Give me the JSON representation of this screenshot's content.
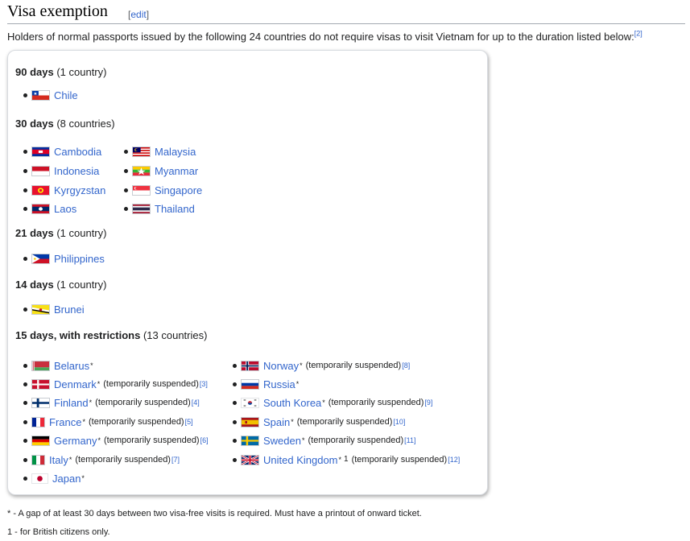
{
  "section": {
    "title": "Visa exemption",
    "edit_open": "[",
    "edit_label": "edit",
    "edit_close": "]"
  },
  "intro": {
    "text": "Holders of normal passports issued by the following 24 countries do not require visas to visit Vietnam for up to the duration listed below:",
    "ref": "[2]"
  },
  "groups": [
    {
      "label": "90 days",
      "count": "(1 country)"
    },
    {
      "label": "30 days",
      "count": "(8 countries)"
    },
    {
      "label": "21 days",
      "count": "(1 country)"
    },
    {
      "label": "14 days",
      "count": "(1 country)"
    },
    {
      "label": "15 days, with restrictions",
      "count": "(13 countries)"
    }
  ],
  "countries": {
    "chile": {
      "name": "Chile"
    },
    "cambodia": {
      "name": "Cambodia"
    },
    "indonesia": {
      "name": "Indonesia"
    },
    "kyrgyzstan": {
      "name": "Kyrgyzstan"
    },
    "laos": {
      "name": "Laos"
    },
    "malaysia": {
      "name": "Malaysia"
    },
    "myanmar": {
      "name": "Myanmar"
    },
    "singapore": {
      "name": "Singapore"
    },
    "thailand": {
      "name": "Thailand"
    },
    "philippines": {
      "name": "Philippines"
    },
    "brunei": {
      "name": "Brunei"
    },
    "belarus": {
      "name": "Belarus",
      "mark": "*"
    },
    "denmark": {
      "name": "Denmark",
      "mark": "*",
      "note": "(temporarily suspended)",
      "ref": "[3]"
    },
    "finland": {
      "name": "Finland",
      "mark": "*",
      "note": "(temporarily suspended)",
      "ref": "[4]"
    },
    "france": {
      "name": "France",
      "mark": "*",
      "note": "(temporarily suspended)",
      "ref": "[5]"
    },
    "germany": {
      "name": "Germany",
      "mark": "*",
      "note": "(temporarily suspended)",
      "ref": "[6]"
    },
    "italy": {
      "name": "Italy",
      "mark": "*",
      "note": "(temporarily suspended)",
      "ref": "[7]"
    },
    "japan": {
      "name": "Japan",
      "mark": "*"
    },
    "norway": {
      "name": "Norway",
      "mark": "*",
      "note": "(temporarily suspended)",
      "ref": "[8]"
    },
    "russia": {
      "name": "Russia",
      "mark": "*"
    },
    "southkorea": {
      "name": "South Korea",
      "mark": "*",
      "note": "(temporarily suspended)",
      "ref": "[9]"
    },
    "spain": {
      "name": "Spain",
      "mark": "*",
      "note": "(temporarily suspended)",
      "ref": "[10]"
    },
    "sweden": {
      "name": "Sweden",
      "mark": "*",
      "note": "(temporarily suspended)",
      "ref": "[11]"
    },
    "uk": {
      "name": "United Kingdom",
      "mark": "*",
      "mark2": "1",
      "note": "(temporarily suspended)",
      "ref": "[12]"
    }
  },
  "footnotes": {
    "star": "* - A gap of at least 30 days between two visa-free visits is required. Must have a printout of onward ticket.",
    "one": "1 - for British citizens only."
  },
  "colors": {
    "link": "#3366cc",
    "text": "#202122",
    "border": "#a2a9b1"
  }
}
